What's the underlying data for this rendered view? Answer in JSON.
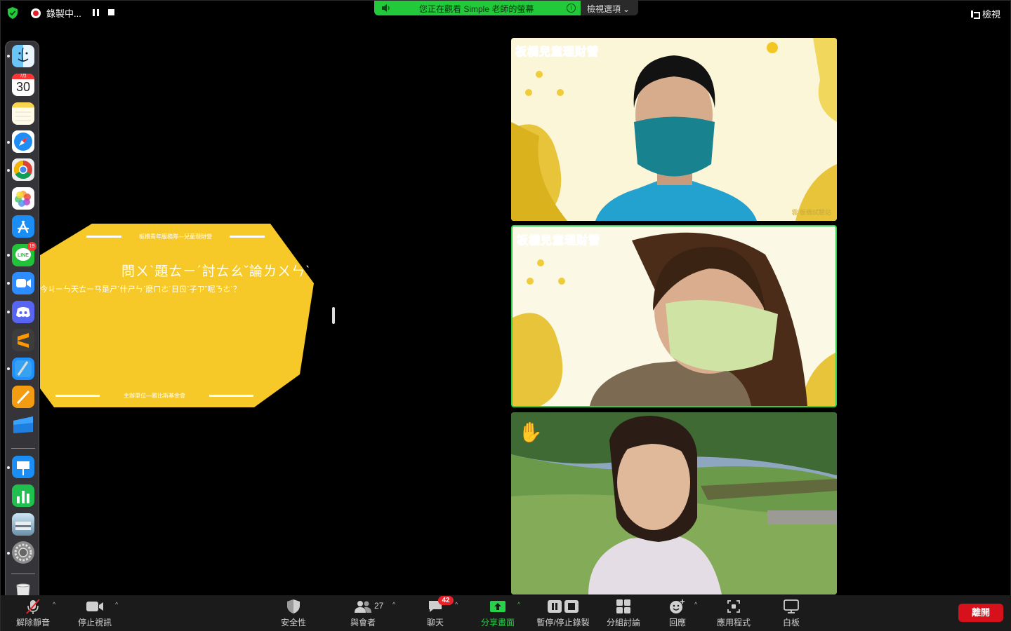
{
  "topbar": {
    "recording_label": "錄製中...",
    "share_banner_text": "您正在觀看 Simple 老師的螢幕",
    "view_options_label": "檢視選項",
    "view_label": "檢視"
  },
  "dock": {
    "calendar_month": "7月",
    "calendar_day": "30",
    "line_badge": "19"
  },
  "slide": {
    "header_text": "板橋青年服務隊—兒童理財營",
    "title": "問ㄨˋ題ㄊㄧˊ討ㄊㄠˇ論ㄌㄨㄣˋ",
    "question": "今ㄐㄧㄣ天ㄊㄧㄢ是ㄕˋ什ㄕㄣˊ麼ㄇㄜ˙日ㄖˋ子ㄗˇ呢ㄋㄜ˙？",
    "footer_text": "主辦單位—雅比斯基金會"
  },
  "tiles": [
    {
      "banner": "板橋兒童理財營",
      "corner_text": "雲 板橋試驗站"
    },
    {
      "banner": "板橋兒童理財營"
    },
    {
      "reaction": "✋"
    }
  ],
  "toolbar": {
    "unmute_label": "解除靜音",
    "stop_video_label": "停止視訊",
    "security_label": "安全性",
    "participants_label": "與會者",
    "participants_count": "27",
    "chat_label": "聊天",
    "chat_badge": "42",
    "share_label": "分享畫面",
    "record_label": "暫停/停止錄製",
    "breakout_label": "分組討論",
    "reactions_label": "回應",
    "apps_label": "應用程式",
    "whiteboard_label": "白板",
    "leave_label": "離開"
  },
  "colors": {
    "share_green": "#22c93a",
    "active_speaker": "#2fd14a",
    "slide_yellow": "#f7c928",
    "leave_red": "#d6111b"
  }
}
